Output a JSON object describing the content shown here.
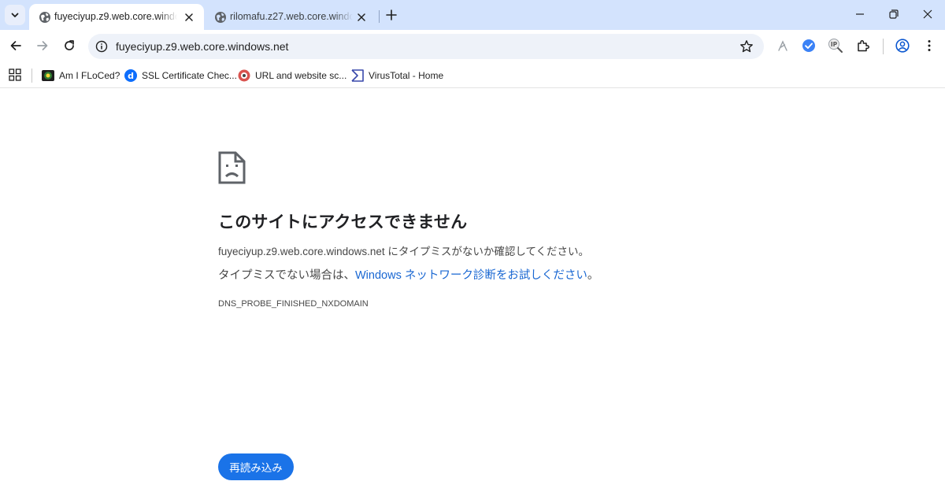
{
  "tabs": [
    {
      "title": "fuyeciyup.z9.web.core.windows.net",
      "active": true
    },
    {
      "title": "rilomafu.z27.web.core.windows.net",
      "active": false
    }
  ],
  "omnibox": {
    "url": "fuyeciyup.z9.web.core.windows.net"
  },
  "bookmarks": [
    {
      "label": "Am I FLoCed?",
      "icon": "floc-icon"
    },
    {
      "label": "SSL Certificate Chec...",
      "icon": "digicert-icon"
    },
    {
      "label": "URL and website sc...",
      "icon": "urlscan-icon"
    },
    {
      "label": "VirusTotal - Home",
      "icon": "virustotal-icon"
    }
  ],
  "error": {
    "title": "このサイトにアクセスできません",
    "line1": "fuyeciyup.z9.web.core.windows.net にタイプミスがないか確認してください。",
    "line2_prefix": "タイプミスでない場合は、",
    "line2_link": "Windows ネットワーク診断をお試しください",
    "line2_suffix": "。",
    "code": "DNS_PROBE_FINISHED_NXDOMAIN",
    "reload_label": "再読み込み"
  },
  "colors": {
    "tabstrip_bg": "#d3e3fd",
    "omnibox_bg": "#eef2f9",
    "link": "#1967d2",
    "button_bg": "#1a73e8"
  }
}
